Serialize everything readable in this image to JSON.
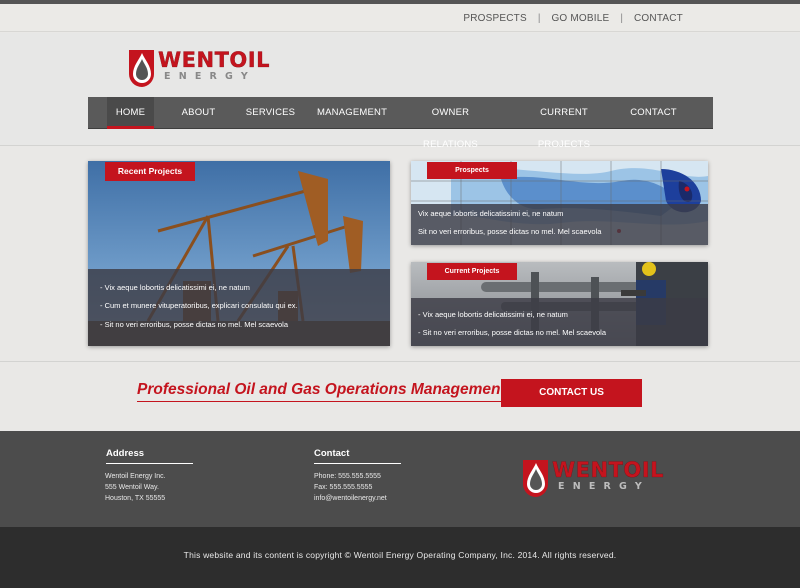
{
  "colors": {
    "accent": "#c4141e",
    "nav_bg": "#5a5a5a",
    "footer_bg": "#4c4c4c",
    "copyright_bg": "#2d2d2d"
  },
  "top_links": [
    "PROSPECTS",
    "GO MOBILE",
    "CONTACT"
  ],
  "top_separator": "|",
  "logo": {
    "word1": "WENTOIL",
    "word2": "ENERGY",
    "icon": "oil-drop-icon"
  },
  "nav": {
    "items": [
      "HOME",
      "ABOUT",
      "SERVICES",
      "MANAGEMENT",
      "OWNER RELATIONS",
      "CURRENT PROJECTS",
      "CONTACT"
    ],
    "active": "HOME"
  },
  "recent_projects": {
    "tab": "Recent Projects",
    "lines": [
      "- Vix aeque lobortis delicatissimi ei, ne natum",
      "- Cum et munere vituperatoribus, explicari consulatu qui ex.",
      "- Sit no veri erroribus, posse dictas no mel. Mel scaevola"
    ]
  },
  "prospects": {
    "tab": "Prospects",
    "lines": [
      "Vix aeque lobortis delicatissimi ei, ne natum",
      "Sit no veri erroribus, posse dictas no mel. Mel scaevola"
    ]
  },
  "current_projects": {
    "tab": "Current Projects",
    "lines": [
      "- Vix aeque lobortis delicatissimi ei, ne natum",
      "- Sit no veri erroribus, posse dictas no mel. Mel scaevola"
    ]
  },
  "tagline": "Professional Oil and Gas Operations Management",
  "cta": "CONTACT US",
  "footer": {
    "address": {
      "heading": "Address",
      "lines": [
        "Wentoil Energy Inc.",
        "555 Wentoil Way.",
        "Houston, TX 55555"
      ]
    },
    "contact": {
      "heading": "Contact",
      "lines": [
        "Phone: 555.555.5555",
        "Fax: 555.555.5555",
        "info@wentoilenergy.net"
      ]
    }
  },
  "copyright": "This website and its content is copyright © Wentoil Energy Operating Company, Inc. 2014. All rights reserved."
}
